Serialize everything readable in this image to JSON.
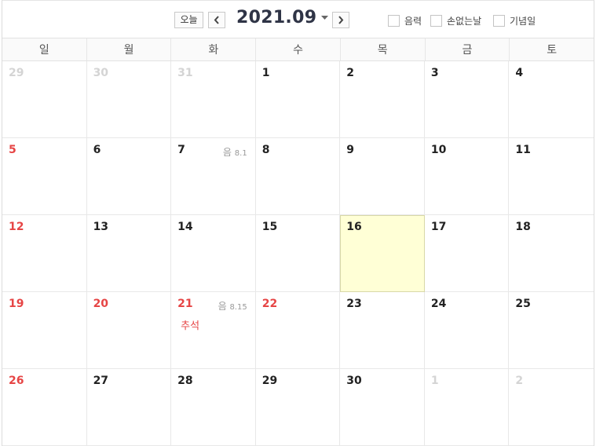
{
  "toolbar": {
    "today_label": "오늘",
    "month_title": "2021.09",
    "lunar_label": "음력",
    "sonless_label": "손없는날",
    "anniversary_label": "기념일"
  },
  "weekdays": [
    "일",
    "월",
    "화",
    "수",
    "목",
    "금",
    "토"
  ],
  "colors": {
    "holiday_red": "#e64545",
    "today_bg": "#ffffd6",
    "other_month": "#d4d4d4"
  },
  "days": [
    {
      "d": "29",
      "other": true
    },
    {
      "d": "30",
      "other": true
    },
    {
      "d": "31",
      "other": true
    },
    {
      "d": "1"
    },
    {
      "d": "2"
    },
    {
      "d": "3"
    },
    {
      "d": "4"
    },
    {
      "d": "5",
      "red": true
    },
    {
      "d": "6"
    },
    {
      "d": "7",
      "lunar_prefix": "음",
      "lunar": "8.1"
    },
    {
      "d": "8"
    },
    {
      "d": "9"
    },
    {
      "d": "10"
    },
    {
      "d": "11"
    },
    {
      "d": "12",
      "red": true
    },
    {
      "d": "13"
    },
    {
      "d": "14"
    },
    {
      "d": "15"
    },
    {
      "d": "16",
      "today": true
    },
    {
      "d": "17"
    },
    {
      "d": "18"
    },
    {
      "d": "19",
      "red": true
    },
    {
      "d": "20",
      "red": true
    },
    {
      "d": "21",
      "red": true,
      "lunar_prefix": "음",
      "lunar": "8.15",
      "holiday": "추석"
    },
    {
      "d": "22",
      "red": true
    },
    {
      "d": "23"
    },
    {
      "d": "24"
    },
    {
      "d": "25"
    },
    {
      "d": "26",
      "red": true
    },
    {
      "d": "27"
    },
    {
      "d": "28"
    },
    {
      "d": "29"
    },
    {
      "d": "30"
    },
    {
      "d": "1",
      "other": true
    },
    {
      "d": "2",
      "other": true
    }
  ]
}
